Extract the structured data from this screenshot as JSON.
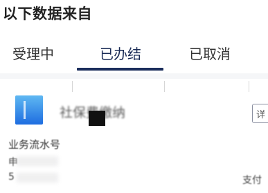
{
  "header": {
    "title": "以下数据来自"
  },
  "tabs": [
    {
      "label": "受理中",
      "active": false
    },
    {
      "label": "已办结",
      "active": true
    },
    {
      "label": "已取消",
      "active": false
    },
    {
      "label": "",
      "active": false
    }
  ],
  "colors": {
    "active_tab_text": "#1a2b56",
    "active_tab_underline": "#1b2d5c",
    "record_icon_top": "#5fb8f2",
    "record_icon_bottom": "#1e6de0"
  },
  "record": {
    "icon": "document-tile-icon",
    "title": "社保费缴纳",
    "action_button_label": "详",
    "fields": {
      "serial_label": "业务流水号",
      "row2_prefix": "申",
      "row3_prefix": "5",
      "right_text": "支付"
    }
  }
}
